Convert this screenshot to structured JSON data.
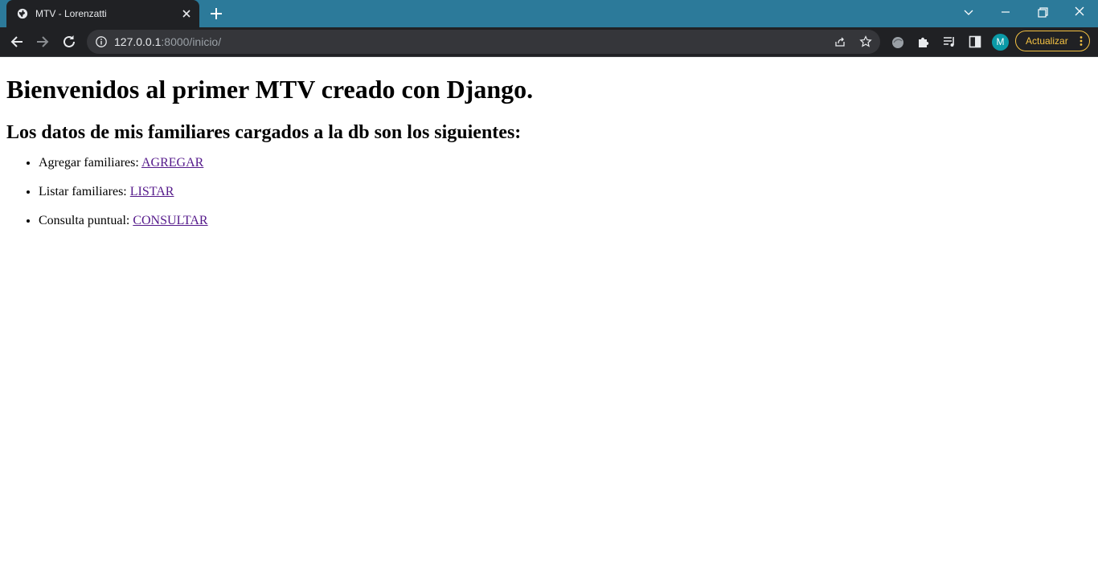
{
  "browser": {
    "tab": {
      "title": "MTV - Lorenzatti",
      "favicon": "globe-icon"
    },
    "address": {
      "host": "127.0.0.1",
      "rest": ":8000/inicio/"
    },
    "profile_initial": "M",
    "update_label": "Actualizar",
    "colors": {
      "titlebar": "#2c7a9a",
      "toolbar": "#202124",
      "update_accent": "#f6c343",
      "avatar": "#0b9aa7"
    }
  },
  "page": {
    "heading": "Bienvenidos al primer MTV creado con Django.",
    "subheading": "Los datos de mis familiares cargados a la db son los siguientes:",
    "items": [
      {
        "label": "Agregar familiares: ",
        "link": "AGREGAR"
      },
      {
        "label": "Listar familiares: ",
        "link": "LISTAR"
      },
      {
        "label": "Consulta puntual: ",
        "link": "CONSULTAR"
      }
    ]
  }
}
